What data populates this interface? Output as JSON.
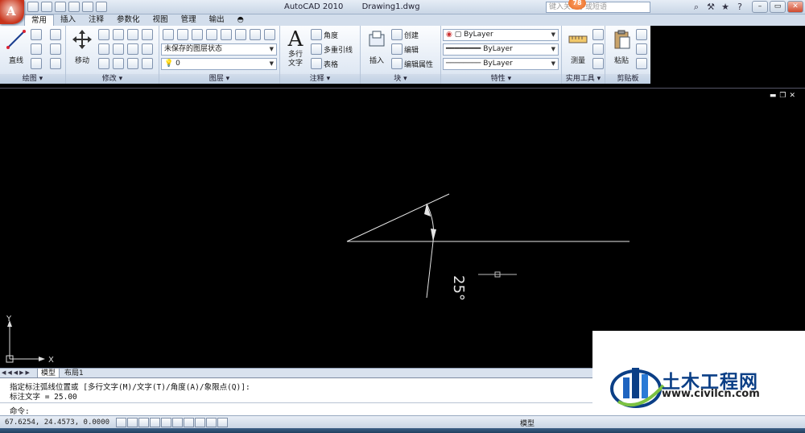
{
  "window": {
    "app": "AutoCAD 2010",
    "file": "Drawing1.dwg",
    "search_placeholder": "键入关键字或短语",
    "badge": "78"
  },
  "tabs": [
    "常用",
    "插入",
    "注释",
    "参数化",
    "视图",
    "管理",
    "输出"
  ],
  "ribbon": {
    "draw": {
      "title": "绘图 ▾",
      "line": "直线"
    },
    "modify": {
      "title": "修改 ▾",
      "move": "移动"
    },
    "layers": {
      "title": "图层 ▾",
      "state": "未保存的图层状态",
      "current": "0"
    },
    "annotation": {
      "title": "注释 ▾",
      "mtext": "多行\n文字",
      "angle": "角度",
      "mleader": "多重引线",
      "table": "表格"
    },
    "block": {
      "title": "块 ▾",
      "insert": "插入",
      "create": "创建",
      "edit": "编辑",
      "attr": "编辑属性"
    },
    "properties": {
      "title": "特性 ▾",
      "color": "ByLayer",
      "linetype": "ByLayer",
      "lineweight": "ByLayer"
    },
    "utilities": {
      "title": "实用工具 ▾",
      "measure": "测量"
    },
    "clipboard": {
      "title": "剪贴板",
      "paste": "粘贴"
    }
  },
  "drawing": {
    "dimension_text": "25°",
    "ucs_x": "X",
    "ucs_y": "Y"
  },
  "layout_tabs": {
    "model": "模型",
    "layout1": "布局1"
  },
  "command": {
    "line1": "指定标注弧线位置或 [多行文字(M)/文字(T)/角度(A)/象限点(Q)]:",
    "line2": "标注文字 = 25.00",
    "prompt": "命令:"
  },
  "status": {
    "coords": "67.6254, 24.4573, 0.0000",
    "model": "模型"
  },
  "watermark": {
    "name": "土木工程网",
    "url": "www.civilcn.com"
  },
  "colors": {
    "ribbon_bg": "#dfe8f3",
    "canvas": "#000000",
    "brand_blue": "#0b3f86"
  }
}
